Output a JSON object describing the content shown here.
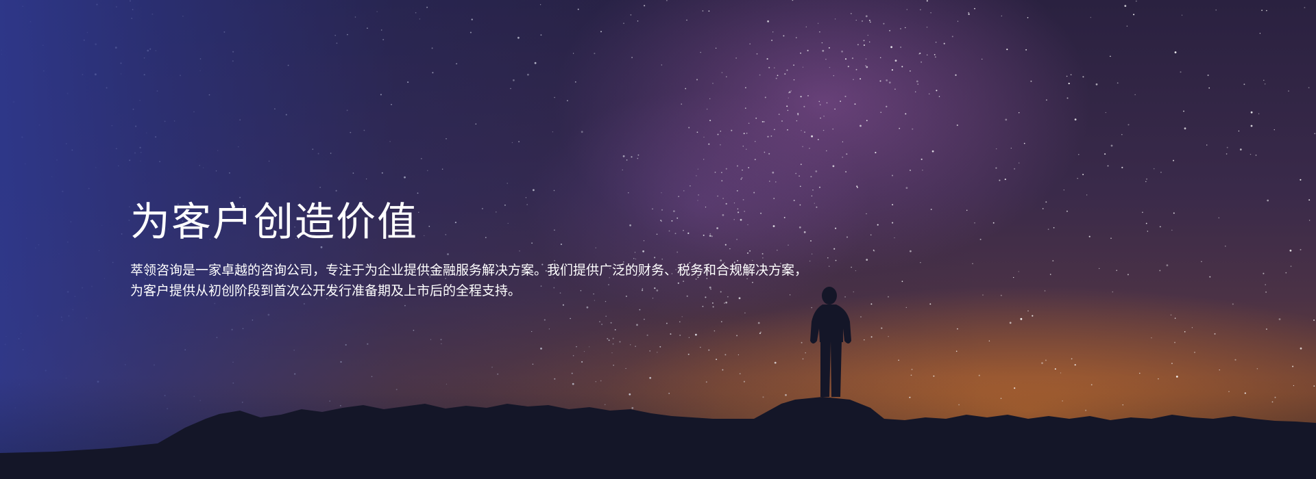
{
  "hero": {
    "headline": "为客户创造价值",
    "description_lines": [
      "萃领咨询是一家卓越的咨询公司，专注于为企业提供金融服务解决方案。我们提供广泛的财务、税务和合规解决方案，",
      "为客户提供从初创阶段到首次公开发行准备期及上市后的全程支持。"
    ]
  },
  "colors": {
    "overlay_blue": "#2e388c",
    "milky_way_purple": "#9e5caa",
    "horizon_orange": "#c6702e",
    "silhouette": "#141628",
    "text": "#ffffff"
  }
}
